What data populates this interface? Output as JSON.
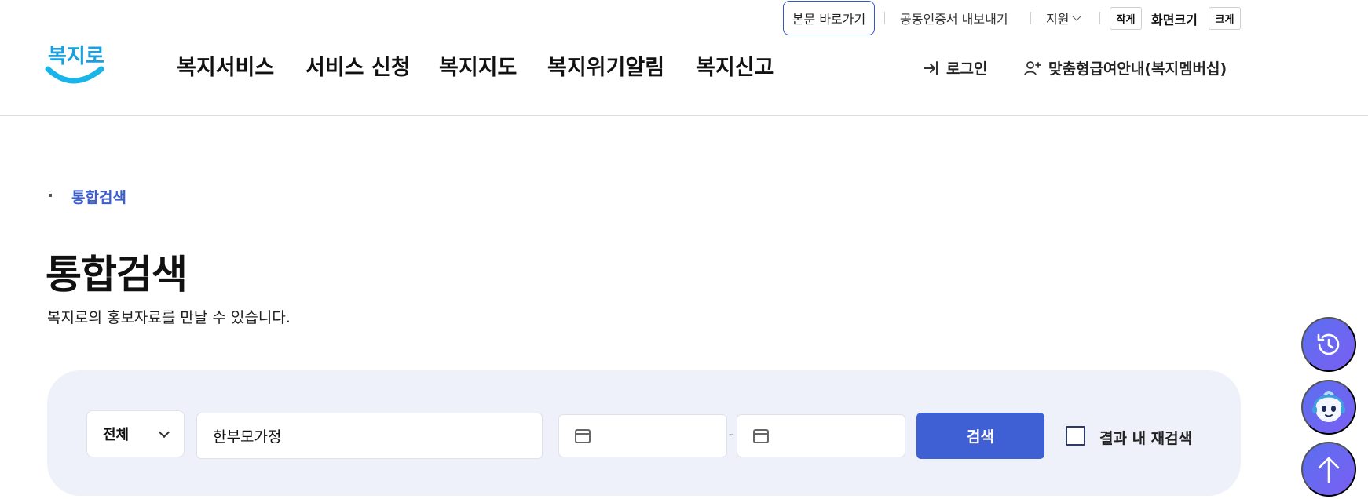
{
  "utility": {
    "skip_to_content": "본문 바로가기",
    "export_certificate": "공동인증서 내보내기",
    "support": "지원",
    "size_small": "작게",
    "screen_size": "화면크기",
    "size_large": "크게"
  },
  "logo": {
    "text": "복지로",
    "color": "#1a9fe0"
  },
  "gnb": [
    {
      "label": "복지서비스"
    },
    {
      "label": "서비스 신청"
    },
    {
      "label": "복지지도"
    },
    {
      "label": "복지위기알림"
    },
    {
      "label": "복지신고"
    }
  ],
  "header_links": {
    "login": "로그인",
    "membership": "맞춤형급여안내(복지멤버십)"
  },
  "breadcrumb": {
    "current": "통합검색"
  },
  "page": {
    "title": "통합검색",
    "description": "복지로의 홍보자료를 만날 수 있습니다."
  },
  "search": {
    "category_selected": "전체",
    "keyword_value": "한부모가정",
    "date_separator": "-",
    "submit_label": "검색",
    "refine_label": "결과 내 재검색"
  },
  "colors": {
    "accent": "#3f60d5",
    "panel_bg": "#eef1f9",
    "breadcrumb": "#3c5fd0",
    "fab": "#6366f1"
  },
  "icons": {
    "login": "login-arrow-icon",
    "membership": "user-plus-icon",
    "calendar": "calendar-icon",
    "recent": "history-icon",
    "chatbot": "chatbot-icon",
    "top": "arrow-up-icon"
  }
}
